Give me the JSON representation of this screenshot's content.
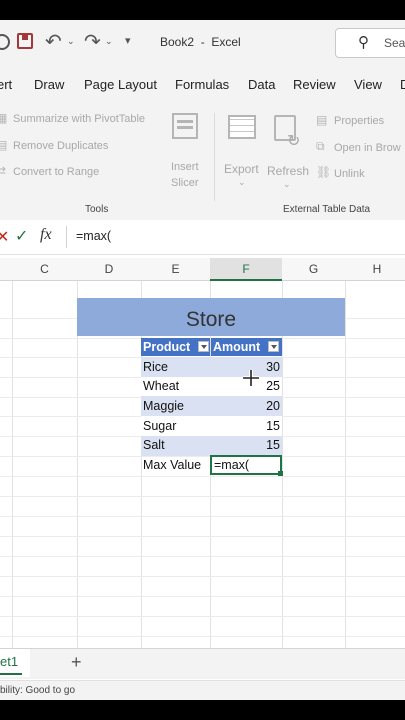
{
  "titlebar": {
    "doc_title": "Book2  -  Excel",
    "search_placeholder": "Sear"
  },
  "menu": [
    "ert",
    "Draw",
    "Page Layout",
    "Formulas",
    "Data",
    "Review",
    "View",
    "D"
  ],
  "ribbon": {
    "tools": {
      "summarize": "Summarize with PivotTable",
      "remove_duplicates": "Remove Duplicates",
      "convert": "Convert to Range",
      "insert_slicer_1": "Insert",
      "insert_slicer_2": "Slicer",
      "group_label": "Tools"
    },
    "external": {
      "export": "Export",
      "refresh": "Refresh",
      "properties": "Properties",
      "open_in_browser": "Open in Brow",
      "unlink": "Unlink",
      "group_label": "External Table Data"
    }
  },
  "formula_bar": {
    "fx_label": "fx",
    "value": "=max("
  },
  "columns": [
    "C",
    "D",
    "E",
    "F",
    "G",
    "H"
  ],
  "table": {
    "title": "Store",
    "headers": [
      "Product",
      "Amount"
    ],
    "rows": [
      {
        "product": "Rice",
        "amount": "30"
      },
      {
        "product": "Wheat",
        "amount": "25"
      },
      {
        "product": "Maggie",
        "amount": "20"
      },
      {
        "product": "Sugar",
        "amount": "15"
      },
      {
        "product": "Salt",
        "amount": "15"
      }
    ],
    "max_label": "Max Value",
    "max_formula": "=max("
  },
  "sheet": {
    "tab_name": "et1",
    "add_label": "+"
  },
  "status": {
    "text": "bility: Good to go"
  },
  "colors": {
    "table_header": "#4472c4",
    "banner": "#8eaadb",
    "band": "#d9e1f2",
    "active": "#217346"
  }
}
